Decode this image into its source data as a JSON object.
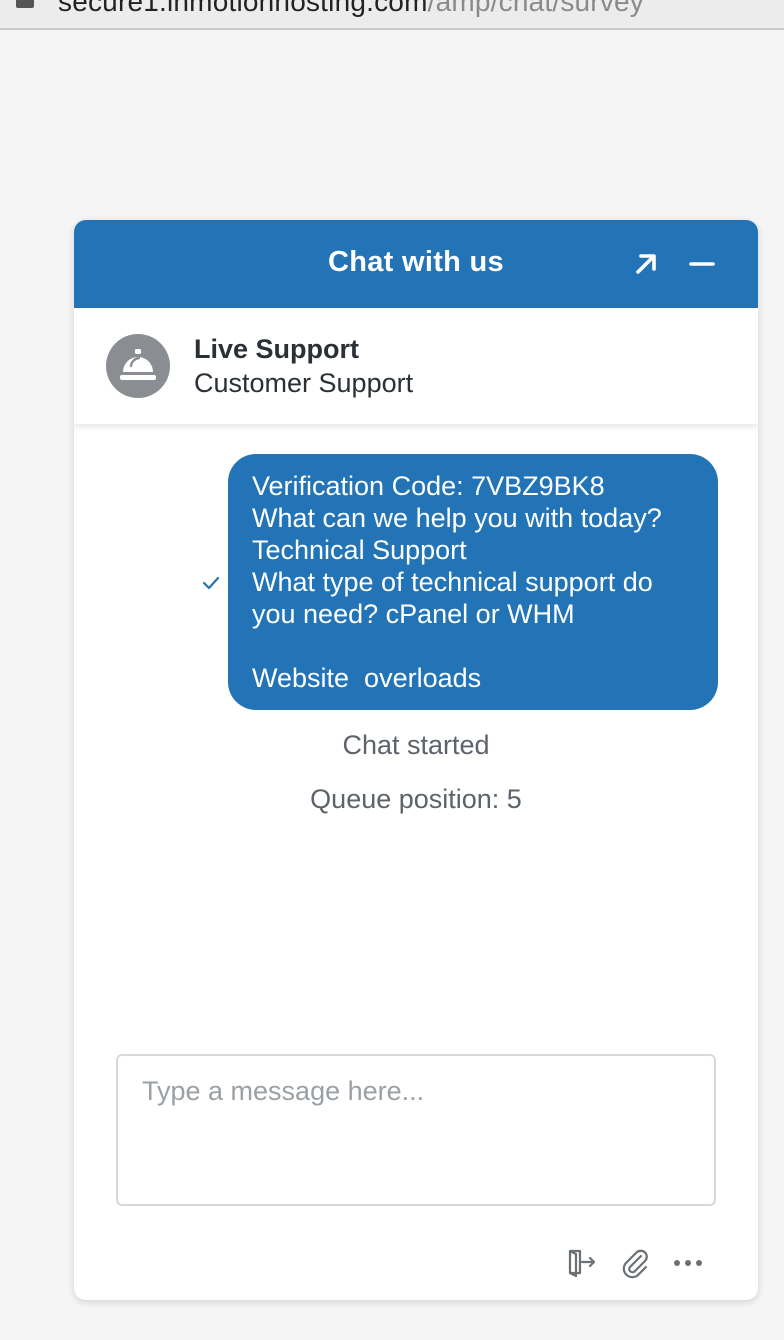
{
  "browser": {
    "url_domain": "secure1.inmotionhosting.com",
    "url_path": "/amp/chat/survey"
  },
  "chat": {
    "title": "Chat with us",
    "popout_icon": "arrow-up-right-icon",
    "minimize_icon": "minus-icon",
    "agent": {
      "name": "Live Support",
      "department": "Customer Support",
      "avatar_icon": "service-bell-icon"
    },
    "message": {
      "lines": [
        "Verification Code: 7VBZ9BK8",
        "What can we help you with today?",
        "Technical Support",
        "What type of technical support do",
        "you need? cPanel or WHM",
        "",
        "Website  overloads"
      ],
      "status_icon": "checkmark-icon"
    },
    "system_messages": {
      "chat_started": "Chat started",
      "queue": "Queue position: 5"
    },
    "composer": {
      "placeholder": "Type a message here..."
    },
    "toolbar": {
      "end_chat_icon": "exit-door-icon",
      "attach_icon": "paperclip-icon",
      "more_icon": "more-dots-icon"
    }
  },
  "colors": {
    "brand": "#2374b6",
    "background": "#f5f5f5",
    "avatar": "#8a8e93"
  }
}
